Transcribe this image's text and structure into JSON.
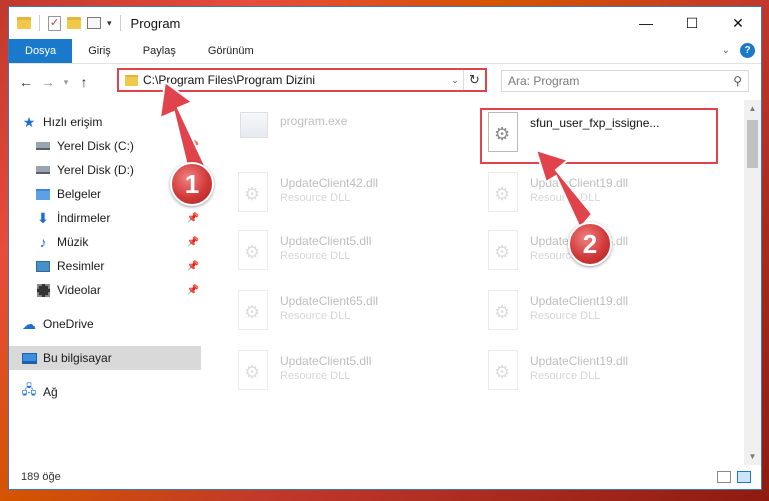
{
  "window": {
    "title": "Program"
  },
  "ribbon": {
    "tabs": [
      "Dosya",
      "Giriş",
      "Paylaş",
      "Görünüm"
    ],
    "help": "?"
  },
  "address": {
    "path": "C:\\Program Files\\Program Dizini"
  },
  "search": {
    "placeholder": "Ara: Program"
  },
  "sidebar": {
    "quick_access": "Hızlı erişim",
    "items": [
      "Yerel Disk (C:)",
      "Yerel Disk (D:)",
      "Belgeler",
      "İndirmeler",
      "Müzik",
      "Resimler",
      "Videolar"
    ],
    "onedrive": "OneDrive",
    "this_pc": "Bu bilgisayar",
    "network": "Ağ"
  },
  "files": {
    "exe": {
      "name": "program.exe"
    },
    "dll_highlight": {
      "name": "sfun_user_fxp_issigne..."
    },
    "list": [
      {
        "name": "UpdateClient42.dll",
        "type": "Resource DLL"
      },
      {
        "name": "UpdateClient19.dll",
        "type": "Resource DLL"
      },
      {
        "name": "UpdateClient5.dll",
        "type": "Resource DLL"
      },
      {
        "name": "UpdateClient65.dll",
        "type": "Resource DLL"
      },
      {
        "name": "UpdateClient65.dll",
        "type": "Resource DLL"
      },
      {
        "name": "UpdateClient19.dll",
        "type": "Resource DLL"
      },
      {
        "name": "UpdateClient5.dll",
        "type": "Resource DLL"
      },
      {
        "name": "UpdateClient19.dll",
        "type": "Resource DLL"
      }
    ]
  },
  "status": {
    "count": "189 öğe"
  },
  "annotations": {
    "step1": "1",
    "step2": "2",
    "accent": "#e0434c"
  }
}
